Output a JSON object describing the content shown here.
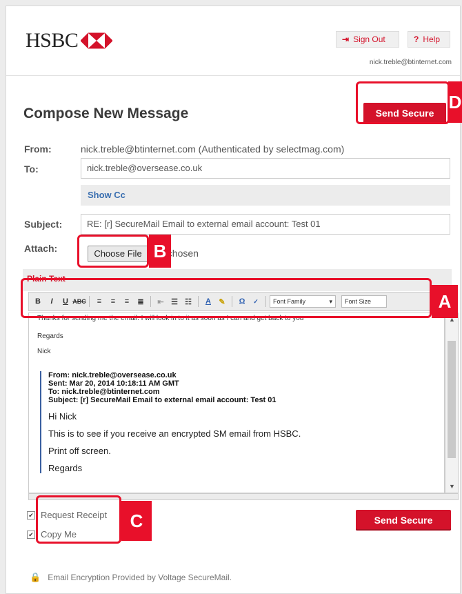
{
  "header": {
    "logo_text": "HSBC",
    "sign_out": "Sign Out",
    "help": "Help",
    "user_email": "nick.treble@btinternet.com"
  },
  "compose": {
    "title": "Compose New Message",
    "send_label": "Send Secure",
    "from_label": "From:",
    "from_value": "nick.treble@btinternet.com (Authenticated by selectmag.com)",
    "to_label": "To:",
    "to_value": "nick.treble@oversease.co.uk",
    "show_cc": "Show Cc",
    "subject_label": "Subject:",
    "subject_value": "RE: [r] SecureMail Email to external email account: Test 01",
    "attach_label": "Attach:",
    "choose_file": "Choose File",
    "no_file": "file chosen",
    "plain_text": "Plain Text"
  },
  "toolbar": {
    "font_family": "Font Family",
    "font_size": "Font Size"
  },
  "body": {
    "line1": "Thanks for sending me the email. I will look in to it as soon as I can and get back to you",
    "regards": "Regards",
    "name": "Nick",
    "q_from": "From: nick.treble@oversease.co.uk",
    "q_sent": "Sent: Mar 20, 2014 10:18:11 AM GMT",
    "q_to": "To: nick.treble@btinternet.com",
    "q_subject": "Subject: [r] SecureMail Email to external email account: Test 01",
    "q_hi": "Hi Nick",
    "q_body": "This is to see if you receive an encrypted SM email from HSBC.",
    "q_print": "Print off screen.",
    "q_regards": "Regards"
  },
  "options": {
    "request_receipt": "Request Receipt",
    "copy_me": "Copy Me"
  },
  "footer": {
    "text": "Email Encryption Provided by Voltage SecureMail."
  },
  "annotations": {
    "a": "A",
    "b": "B",
    "c": "C",
    "d": "D"
  },
  "colors": {
    "brand_red": "#d4122a",
    "annotation_red": "#e8102a"
  }
}
